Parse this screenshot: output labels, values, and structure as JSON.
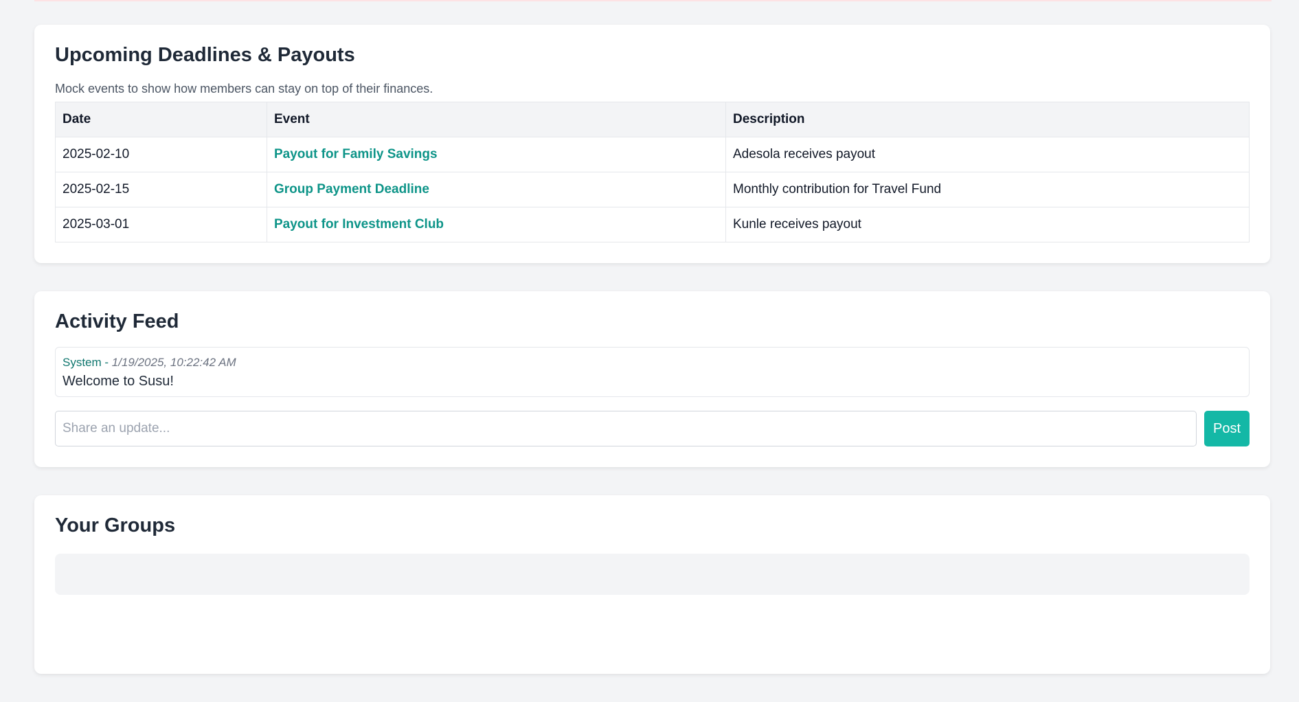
{
  "deadlines": {
    "title": "Upcoming Deadlines & Payouts",
    "subtitle": "Mock events to show how members can stay on top of their finances.",
    "columns": [
      "Date",
      "Event",
      "Description"
    ],
    "rows": [
      {
        "date": "2025-02-10",
        "event": "Payout for Family Savings",
        "description": "Adesola receives payout"
      },
      {
        "date": "2025-02-15",
        "event": "Group Payment Deadline",
        "description": "Monthly contribution for Travel Fund"
      },
      {
        "date": "2025-03-01",
        "event": "Payout for Investment Club",
        "description": "Kunle receives payout"
      }
    ]
  },
  "activity": {
    "title": "Activity Feed",
    "items": [
      {
        "author": "System",
        "separator": " - ",
        "timestamp": "1/19/2025, 10:22:42 AM",
        "message": "Welcome to Susu!"
      }
    ],
    "input_placeholder": "Share an update...",
    "post_label": "Post"
  },
  "groups": {
    "title": "Your Groups"
  },
  "colors": {
    "accent": "#14b8a6",
    "link": "#0d9488",
    "background": "#f3f4f6"
  }
}
